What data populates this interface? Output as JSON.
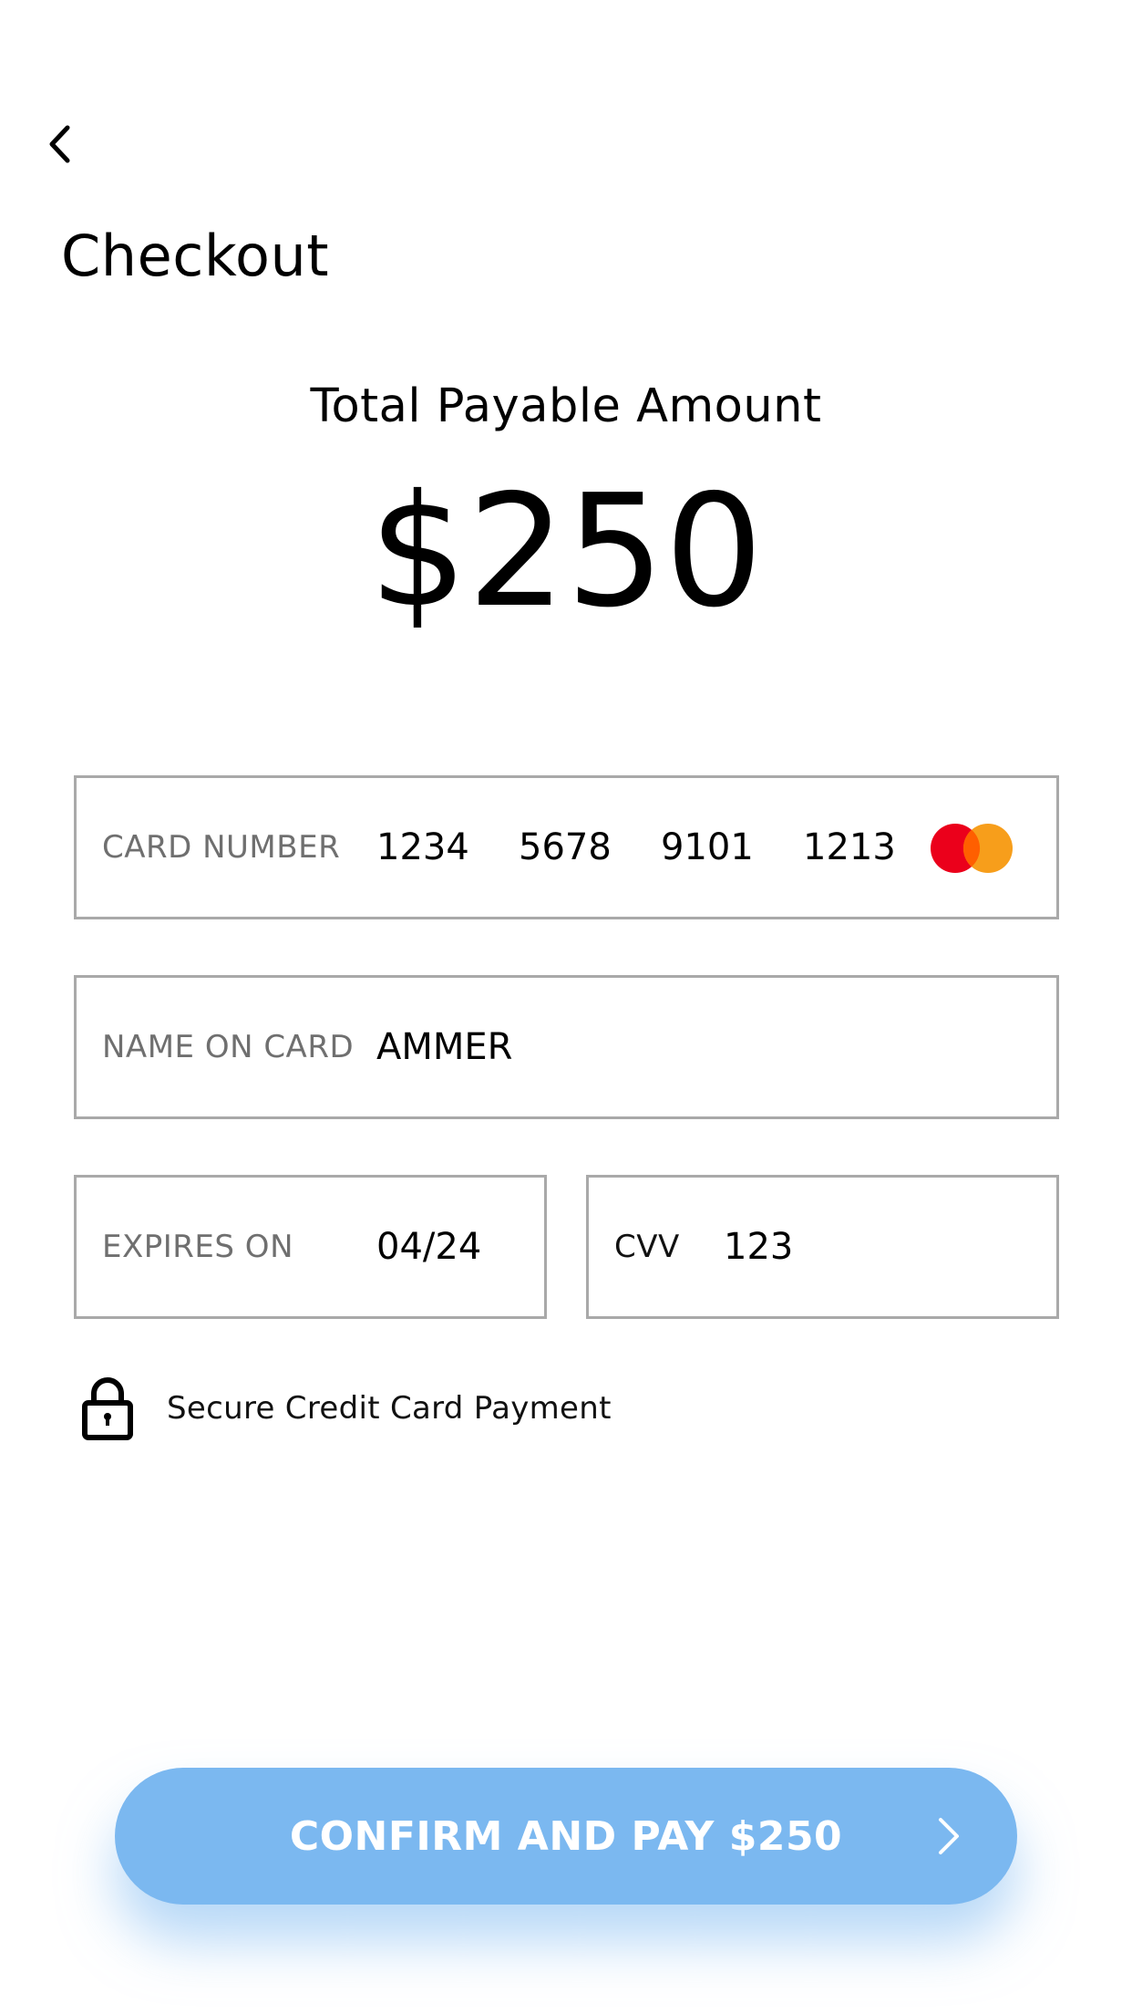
{
  "header": {
    "back_icon": "chevron-left-icon",
    "title": "Checkout"
  },
  "summary": {
    "label": "Total Payable Amount",
    "amount": "$250"
  },
  "card_number": {
    "label": "CARD NUMBER",
    "groups": [
      "1234",
      "5678",
      "9101",
      "1213"
    ],
    "brand_icon": "mastercard-icon",
    "brand_colors": [
      "#eb001b",
      "#f79e1b"
    ]
  },
  "name_on_card": {
    "label": "NAME ON CARD",
    "value": "AMMER"
  },
  "expiry": {
    "label": "EXPIRES ON",
    "value": "04/24"
  },
  "cvv": {
    "label": "CVV",
    "value": "123"
  },
  "security": {
    "icon": "lock-icon",
    "text": "Secure Credit Card Payment"
  },
  "pay_button": {
    "label": "CONFIRM AND PAY $250",
    "icon": "chevron-right-icon",
    "color": "#7bb8f0"
  },
  "colors": {
    "field_border": "#a9a9a9",
    "label_text": "#6f6f6f",
    "text": "#000000",
    "background": "#ffffff"
  }
}
